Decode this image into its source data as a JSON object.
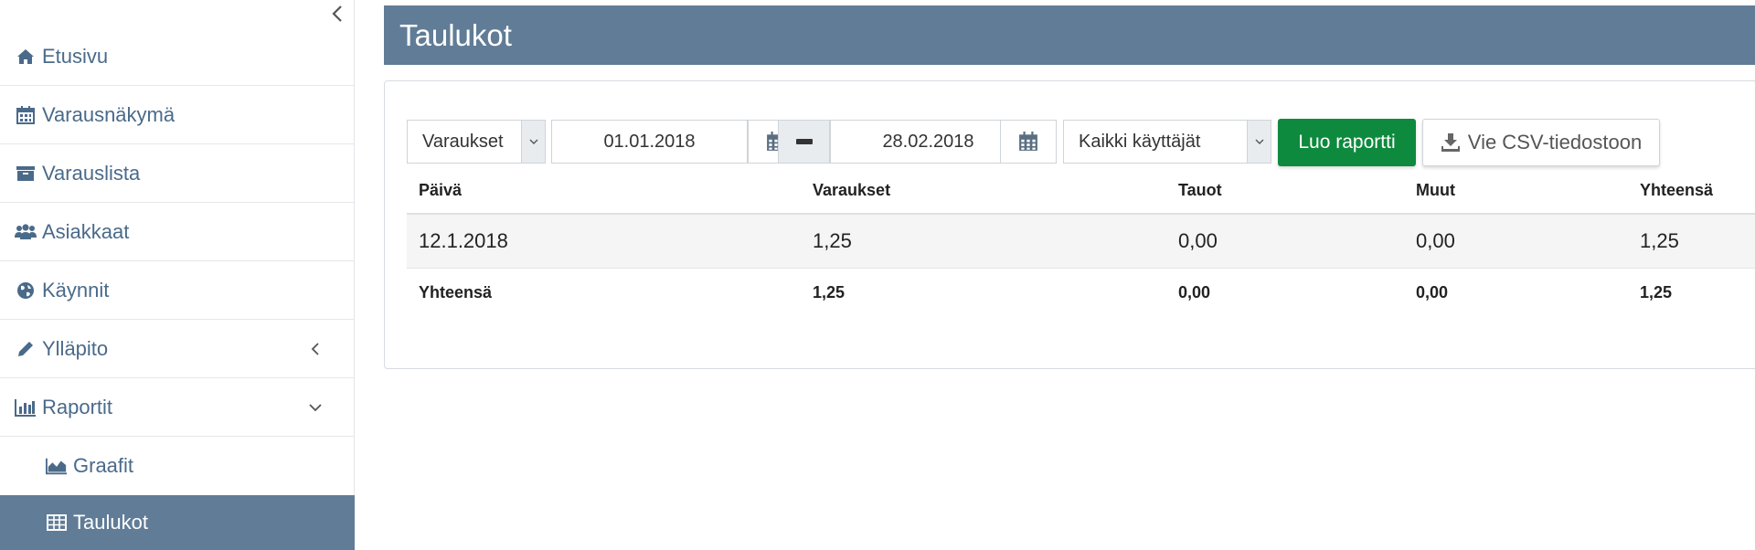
{
  "sidebar": {
    "items": [
      {
        "label": "Etusivu",
        "icon": "home-icon"
      },
      {
        "label": "Varausnäkymä",
        "icon": "calendar-icon"
      },
      {
        "label": "Varauslista",
        "icon": "archive-icon"
      },
      {
        "label": "Asiakkaat",
        "icon": "users-icon"
      },
      {
        "label": "Käynnit",
        "icon": "globe-icon"
      },
      {
        "label": "Ylläpito",
        "icon": "pencil-icon"
      },
      {
        "label": "Raportit",
        "icon": "bar-chart-icon"
      },
      {
        "label": "Graafit",
        "icon": "area-chart-icon"
      },
      {
        "label": "Taulukot",
        "icon": "table-icon"
      }
    ],
    "active": "Taulukot"
  },
  "header": {
    "title": "Taulukot"
  },
  "filters": {
    "report_type": "Varaukset",
    "start_date": "01.01.2018",
    "end_date": "28.02.2018",
    "user": "Kaikki käyttäjät",
    "create_button": "Luo raportti",
    "csv_button": "Vie CSV-tiedostoon"
  },
  "table": {
    "columns": [
      "Päivä",
      "Varaukset",
      "Tauot",
      "Muut",
      "Yhteensä"
    ],
    "rows": [
      [
        "12.1.2018",
        "1,25",
        "0,00",
        "0,00",
        "1,25"
      ]
    ],
    "totals": [
      "Yhteensä",
      "1,25",
      "0,00",
      "0,00",
      "1,25"
    ]
  },
  "colors": {
    "header_bg": "#617c96",
    "active_nav_bg": "#617c96",
    "nav_text": "#4a6a8a",
    "primary_button": "#0e8a3e"
  }
}
